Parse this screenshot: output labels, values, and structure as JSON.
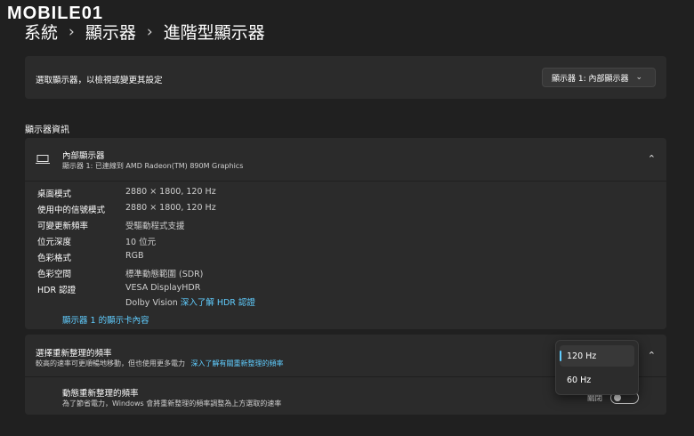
{
  "logo": {
    "text": "MOBILE01"
  },
  "breadcrumb": {
    "items": [
      "系統",
      "顯示器",
      "進階型顯示器"
    ],
    "separator": "›"
  },
  "select_display": {
    "label": "選取顯示器，以檢視或變更其設定",
    "value": "顯示器 1: 內部顯示器"
  },
  "info_section": {
    "title": "顯示器資訊"
  },
  "internal_display": {
    "title": "內部顯示器",
    "subtitle": "顯示器 1: 已連線到 AMD Radeon(TM) 890M Graphics",
    "properties": [
      {
        "key": "桌面模式",
        "value": "2880 × 1800, 120 Hz"
      },
      {
        "key": "使用中的信號模式",
        "value": "2880 × 1800, 120 Hz"
      },
      {
        "key": "可變更新頻率",
        "value": "受驅動程式支援"
      },
      {
        "key": "位元深度",
        "value": "10 位元"
      },
      {
        "key": "色彩格式",
        "value": "RGB"
      },
      {
        "key": "色彩空間",
        "value": "標準動態範圍 (SDR)"
      },
      {
        "key": "HDR 認證",
        "value": "VESA DisplayHDR"
      }
    ],
    "hdr_line2": "Dolby Vision",
    "hdr_link": "深入了解 HDR 認證",
    "adapter_link": "顯示器 1 的顯示卡內容"
  },
  "refresh_rate": {
    "title": "選擇重新整理的頻率",
    "desc": "較高的速率可更順暢地移動，但也使用更多電力",
    "link": "深入了解有關重新整理的頻率",
    "options": [
      "120 Hz",
      "60 Hz"
    ],
    "selected": "120 Hz"
  },
  "dynamic_refresh": {
    "title": "動態重新整理的頻率",
    "desc": "為了節省電力，Windows 會將重新整理的頻率調整為上方選取的速率",
    "state_label": "關閉"
  },
  "colors": {
    "accent": "#60cdff",
    "background": "#202020",
    "card": "#2b2b2b"
  }
}
